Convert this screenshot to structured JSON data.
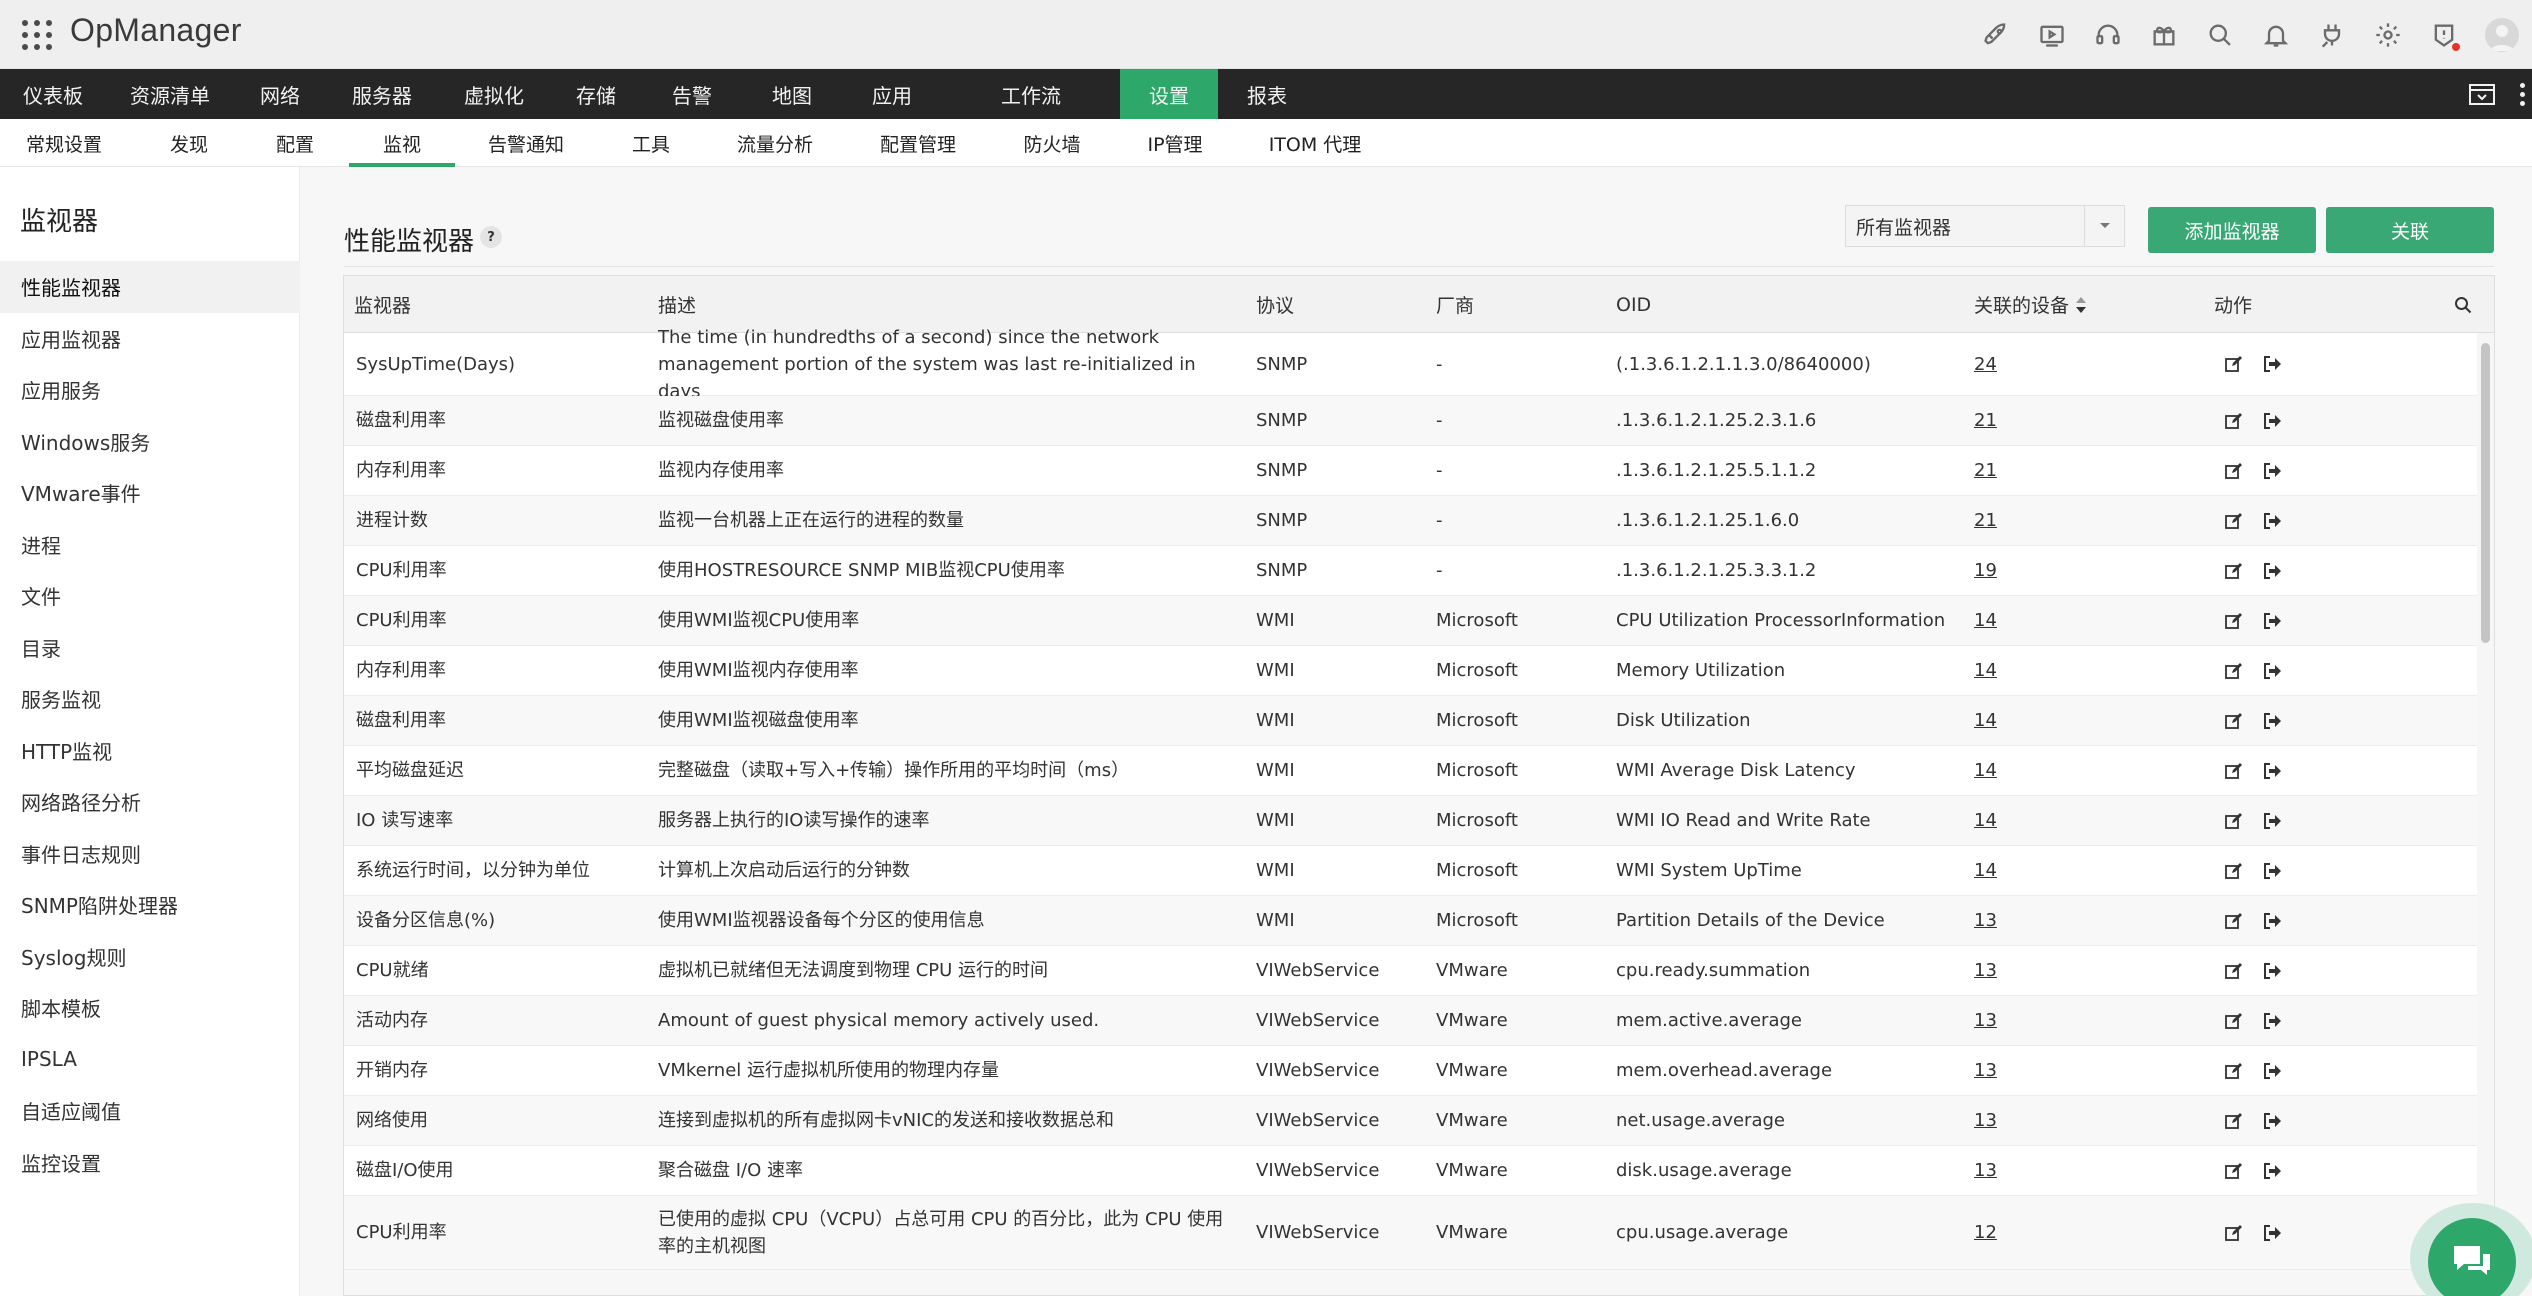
{
  "app": {
    "title": "OpManager"
  },
  "header_icons": [
    "rocket-icon",
    "video-icon",
    "headset-icon",
    "gift-icon",
    "search-icon",
    "bell-icon",
    "plug-icon",
    "gear-icon",
    "alert-shield-icon",
    "user-avatar-icon"
  ],
  "main_nav": {
    "items": [
      {
        "label": "仪表板"
      },
      {
        "label": "资源清单"
      },
      {
        "label": "网络"
      },
      {
        "label": "服务器"
      },
      {
        "label": "虚拟化"
      },
      {
        "label": "存储"
      },
      {
        "label": "告警"
      },
      {
        "label": "地图"
      },
      {
        "label": "应用"
      },
      {
        "label": "工作流"
      },
      {
        "label": "设置",
        "active": true
      },
      {
        "label": "报表"
      }
    ]
  },
  "sub_nav": {
    "items": [
      {
        "label": "常规设置"
      },
      {
        "label": "发现"
      },
      {
        "label": "配置"
      },
      {
        "label": "监视",
        "active": true
      },
      {
        "label": "告警通知"
      },
      {
        "label": "工具"
      },
      {
        "label": "流量分析"
      },
      {
        "label": "配置管理"
      },
      {
        "label": "防火墙"
      },
      {
        "label": "IP管理"
      },
      {
        "label": "ITOM 代理"
      }
    ]
  },
  "sidebar": {
    "title": "监视器",
    "items": [
      {
        "label": "性能监视器",
        "active": true
      },
      {
        "label": "应用监视器"
      },
      {
        "label": "应用服务"
      },
      {
        "label": "Windows服务"
      },
      {
        "label": "VMware事件"
      },
      {
        "label": "进程"
      },
      {
        "label": "文件"
      },
      {
        "label": "目录"
      },
      {
        "label": "服务监视"
      },
      {
        "label": "HTTP监视"
      },
      {
        "label": "网络路径分析"
      },
      {
        "label": "事件日志规则"
      },
      {
        "label": "SNMP陷阱处理器"
      },
      {
        "label": "Syslog规则"
      },
      {
        "label": "脚本模板"
      },
      {
        "label": "IPSLA"
      },
      {
        "label": "自适应阈值"
      },
      {
        "label": "监控设置"
      }
    ]
  },
  "main": {
    "page_title": "性能监视器",
    "help": "?",
    "filter": {
      "selected": "所有监视器"
    },
    "add_button": "添加监视器",
    "associate_button": "关联",
    "table": {
      "columns": [
        "监视器",
        "描述",
        "协议",
        "厂商",
        "OID",
        "关联的设备",
        "动作"
      ],
      "rows": [
        [
          "SysUpTime(Days)",
          "The time (in hundredths of a second) since the network management portion of the system was last re-initialized in days",
          "SNMP",
          "-",
          "(.1.3.6.1.2.1.1.3.0/8640000)",
          "24"
        ],
        [
          "磁盘利用率",
          "监视磁盘使用率",
          "SNMP",
          "-",
          ".1.3.6.1.2.1.25.2.3.1.6",
          "21"
        ],
        [
          "内存利用率",
          "监视内存使用率",
          "SNMP",
          "-",
          ".1.3.6.1.2.1.25.5.1.1.2",
          "21"
        ],
        [
          "进程计数",
          "监视一台机器上正在运行的进程的数量",
          "SNMP",
          "-",
          ".1.3.6.1.2.1.25.1.6.0",
          "21"
        ],
        [
          "CPU利用率",
          "使用HOSTRESOURCE SNMP MIB监视CPU使用率",
          "SNMP",
          "-",
          ".1.3.6.1.2.1.25.3.3.1.2",
          "19"
        ],
        [
          "CPU利用率",
          "使用WMI监视CPU使用率",
          "WMI",
          "Microsoft",
          "CPU Utilization ProcessorInformation",
          "14"
        ],
        [
          "内存利用率",
          "使用WMI监视内存使用率",
          "WMI",
          "Microsoft",
          "Memory Utilization",
          "14"
        ],
        [
          "磁盘利用率",
          "使用WMI监视磁盘使用率",
          "WMI",
          "Microsoft",
          "Disk Utilization",
          "14"
        ],
        [
          "平均磁盘延迟",
          "完整磁盘（读取+写入+传输）操作所用的平均时间（ms）",
          "WMI",
          "Microsoft",
          "WMI Average Disk Latency",
          "14"
        ],
        [
          "IO 读写速率",
          "服务器上执行的IO读写操作的速率",
          "WMI",
          "Microsoft",
          "WMI IO Read and Write Rate",
          "14"
        ],
        [
          "系统运行时间，以分钟为单位",
          "计算机上次启动后运行的分钟数",
          "WMI",
          "Microsoft",
          "WMI System UpTime",
          "14"
        ],
        [
          "设备分区信息(%)",
          "使用WMI监视器设备每个分区的使用信息",
          "WMI",
          "Microsoft",
          "Partition Details of the Device",
          "13"
        ],
        [
          "CPU就绪",
          "虚拟机已就绪但无法调度到物理 CPU 运行的时间",
          "VIWebService",
          "VMware",
          "cpu.ready.summation",
          "13"
        ],
        [
          "活动内存",
          "Amount of guest physical memory actively used.",
          "VIWebService",
          "VMware",
          "mem.active.average",
          "13"
        ],
        [
          "开销内存",
          "VMkernel 运行虚拟机所使用的物理内存量",
          "VIWebService",
          "VMware",
          "mem.overhead.average",
          "13"
        ],
        [
          "网络使用",
          "连接到虚拟机的所有虚拟网卡vNIC的发送和接收数据总和",
          "VIWebService",
          "VMware",
          "net.usage.average",
          "13"
        ],
        [
          "磁盘I/O使用",
          "聚合磁盘 I/O 速率",
          "VIWebService",
          "VMware",
          "disk.usage.average",
          "13"
        ],
        [
          "CPU利用率",
          "已使用的虚拟 CPU（VCPU）占总可用 CPU 的百分比，此为 CPU 使用率的主机视图",
          "VIWebService",
          "VMware",
          "cpu.usage.average",
          "12"
        ]
      ]
    }
  }
}
